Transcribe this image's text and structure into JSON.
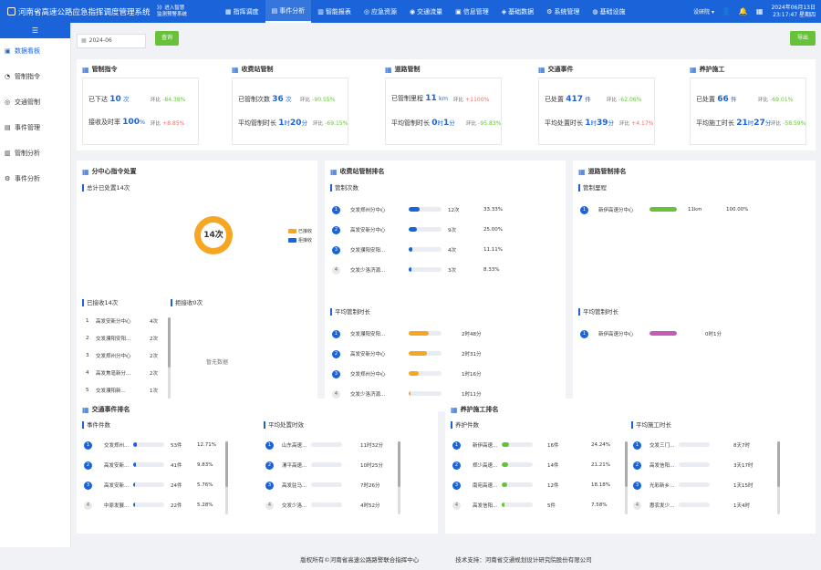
{
  "header": {
    "title": "河南省高速公路应急指挥调度管理系统",
    "enter_line1": "》》进入智慧",
    "enter_line2": "监测预警系统",
    "nav": [
      {
        "label": "指挥调度",
        "icon": "grid-icon"
      },
      {
        "label": "事件分析",
        "icon": "chart-icon"
      },
      {
        "label": "智能报表",
        "icon": "report-icon"
      },
      {
        "label": "应急资源",
        "icon": "resource-icon"
      },
      {
        "label": "交通流量",
        "icon": "traffic-icon"
      },
      {
        "label": "信息管理",
        "icon": "info-icon"
      },
      {
        "label": "基础数据",
        "icon": "data-icon"
      },
      {
        "label": "系统管理",
        "icon": "settings-icon"
      },
      {
        "label": "基础设施",
        "icon": "facility-icon"
      }
    ],
    "user": "设研院",
    "date": "2024年06月13日",
    "time": "23:17:47 星期四"
  },
  "sidebar": {
    "toggle": "☰",
    "items": [
      {
        "label": "数据看板",
        "icon": "dashboard-icon"
      },
      {
        "label": "管制指令",
        "icon": "command-icon"
      },
      {
        "label": "交通管制",
        "icon": "control-icon"
      },
      {
        "label": "事件管理",
        "icon": "event-icon"
      },
      {
        "label": "管制分析",
        "icon": "analysis-icon"
      },
      {
        "label": "事件分析",
        "icon": "event-analysis-icon"
      }
    ]
  },
  "filter": {
    "date": "2024-06",
    "query_label": "查询",
    "export_label": "导出"
  },
  "stats": [
    {
      "title": "管制指令",
      "r1_label": "已下达",
      "r1_val": "10",
      "r1_unit": "次",
      "r1_pct": "-84.38%",
      "r1_dir": "down",
      "r2_label": "接收及时率",
      "r2_val": "100",
      "r2_unit": "%",
      "r2_pct": "+8.85%",
      "r2_dir": "up"
    },
    {
      "title": "收费站管制",
      "r1_label": "已管制次数",
      "r1_val": "36",
      "r1_unit": "次",
      "r1_pct": "-90.55%",
      "r1_dir": "down",
      "r2_label": "平均管制时长",
      "r2_val": "1",
      "r2_unit": "时",
      "r2_val2": "20",
      "r2_unit2": "分",
      "r2_pct": "-69.15%",
      "r2_dir": "down"
    },
    {
      "title": "道路管制",
      "r1_label": "已管制里程",
      "r1_val": "11",
      "r1_unit": "km",
      "r1_pct": "+1100%",
      "r1_dir": "up",
      "r2_label": "平均管制时长",
      "r2_val": "0",
      "r2_unit": "时",
      "r2_val2": "1",
      "r2_unit2": "分",
      "r2_pct": "-95.83%",
      "r2_dir": "down"
    },
    {
      "title": "交通事件",
      "r1_label": "已处置",
      "r1_val": "417",
      "r1_unit": "件",
      "r1_pct": "-62.06%",
      "r1_dir": "down",
      "r2_label": "平均处置时长",
      "r2_val": "1",
      "r2_unit": "时",
      "r2_val2": "39",
      "r2_unit2": "分",
      "r2_pct": "+4.17%",
      "r2_dir": "up"
    },
    {
      "title": "养护施工",
      "r1_label": "已处置",
      "r1_val": "66",
      "r1_unit": "件",
      "r1_pct": "-69.01%",
      "r1_dir": "down",
      "r2_label": "平均施工时长",
      "r2_val": "21",
      "r2_unit": "时",
      "r2_val2": "27",
      "r2_unit2": "分",
      "r2_pct": "-58.59%",
      "r2_dir": "down"
    }
  ],
  "compare_label": "环比",
  "center": {
    "title": "分中心指令处置",
    "total_label": "总计已处置14次",
    "donut_value": "14次",
    "legend": [
      {
        "label": "已接收",
        "color": "#f5a623"
      },
      {
        "label": "拒接收",
        "color": "#1a63d8"
      }
    ],
    "received_label": "已接收14次",
    "rejected_label": "拒接收0次",
    "no_data": "暂无数据",
    "rows": [
      {
        "rank": "1",
        "name": "高发安新分中心",
        "count": "4次"
      },
      {
        "rank": "2",
        "name": "交发濮阳安阳...",
        "count": "2次"
      },
      {
        "rank": "3",
        "name": "交发郑州分中心",
        "count": "2次"
      },
      {
        "rank": "4",
        "name": "高发焦亳新分...",
        "count": "2次"
      },
      {
        "rank": "5",
        "name": "交发濮阳新...",
        "count": "1次"
      }
    ]
  },
  "toll": {
    "title": "收费站管制排名",
    "sec1": "管制次数",
    "rows1": [
      {
        "rank": "1",
        "name": "交发郑州分中心",
        "value": "12次",
        "pct": "33.33%",
        "fill": 0.33,
        "color": "#1a63d8"
      },
      {
        "rank": "2",
        "name": "高发安新分中心",
        "value": "9次",
        "pct": "25.00%",
        "fill": 0.25,
        "color": "#1a63d8"
      },
      {
        "rank": "3",
        "name": "交发濮阳安阳...",
        "value": "4次",
        "pct": "11.11%",
        "fill": 0.11,
        "color": "#1a63d8"
      },
      {
        "rank": "4",
        "name": "交发少洛济源...",
        "value": "3次",
        "pct": "8.33%",
        "fill": 0.08,
        "color": "#1a63d8"
      }
    ],
    "sec2": "平均管制时长",
    "rows2": [
      {
        "rank": "1",
        "name": "交发濮阳安阳...",
        "value": "2时48分",
        "fill": 0.6,
        "color": "#f5a623"
      },
      {
        "rank": "2",
        "name": "高发安新分中心",
        "value": "2时31分",
        "fill": 0.55,
        "color": "#f5a623"
      },
      {
        "rank": "3",
        "name": "交发郑州分中心",
        "value": "1时16分",
        "fill": 0.3,
        "color": "#f5a623"
      },
      {
        "rank": "4",
        "name": "交发少洛济源...",
        "value": "1时11分",
        "fill": 0.05,
        "color": "#f5a623"
      }
    ]
  },
  "road": {
    "title": "道路管制排名",
    "sec1": "管制里程",
    "rows1": [
      {
        "rank": "1",
        "name": "新伊高速分中心",
        "value": "11km",
        "pct": "100.00%",
        "fill": 1.0,
        "color": "#67c23a"
      }
    ],
    "sec2": "平均管制时长",
    "rows2": [
      {
        "rank": "1",
        "name": "新伊高速分中心",
        "value": "0时1分",
        "fill": 1.0,
        "color": "#c45cb8"
      }
    ]
  },
  "traffic": {
    "title": "交通事件排名",
    "sec1": "事件件数",
    "rows1": [
      {
        "rank": "1",
        "name": "交发郑州...",
        "value": "53件",
        "pct": "12.71%",
        "fill": 0.13
      },
      {
        "rank": "2",
        "name": "高发安新...",
        "value": "41件",
        "pct": "9.83%",
        "fill": 0.1
      },
      {
        "rank": "3",
        "name": "高发安新...",
        "value": "24件",
        "pct": "5.76%",
        "fill": 0.06
      },
      {
        "rank": "4",
        "name": "中原发展...",
        "value": "22件",
        "pct": "5.28%",
        "fill": 0.05
      }
    ],
    "sec2": "平均处置时效",
    "rows2": [
      {
        "rank": "1",
        "name": "山东高速...",
        "value": "11时32分"
      },
      {
        "rank": "2",
        "name": "漯平高速...",
        "value": "10时25分"
      },
      {
        "rank": "3",
        "name": "高发驻马...",
        "value": "7时26分"
      },
      {
        "rank": "4",
        "name": "交发少洛...",
        "value": "4时52分"
      }
    ]
  },
  "maint": {
    "title": "养护施工排名",
    "sec1": "养护件数",
    "rows1": [
      {
        "rank": "1",
        "name": "新伊高速...",
        "value": "16件",
        "pct": "24.24%",
        "fill": 0.24
      },
      {
        "rank": "2",
        "name": "郑少高速...",
        "value": "14件",
        "pct": "21.21%",
        "fill": 0.21
      },
      {
        "rank": "3",
        "name": "南宛高速...",
        "value": "12件",
        "pct": "18.18%",
        "fill": 0.18
      },
      {
        "rank": "4",
        "name": "高发信阳...",
        "value": "5件",
        "pct": "7.58%",
        "fill": 0.08
      }
    ],
    "sec2": "平均施工时长",
    "rows2": [
      {
        "rank": "1",
        "name": "交发三门...",
        "value": "8天7时"
      },
      {
        "rank": "2",
        "name": "高发信阳...",
        "value": "3天17时"
      },
      {
        "rank": "3",
        "name": "光彩新乡...",
        "value": "1天15时"
      },
      {
        "rank": "4",
        "name": "惠农发少...",
        "value": "1天4时"
      }
    ]
  },
  "footer": {
    "copyright": "版权所有©河南省高速公路路警联合指挥中心",
    "support": "技术支持：河南省交通规划设计研究院股份有限公司"
  }
}
